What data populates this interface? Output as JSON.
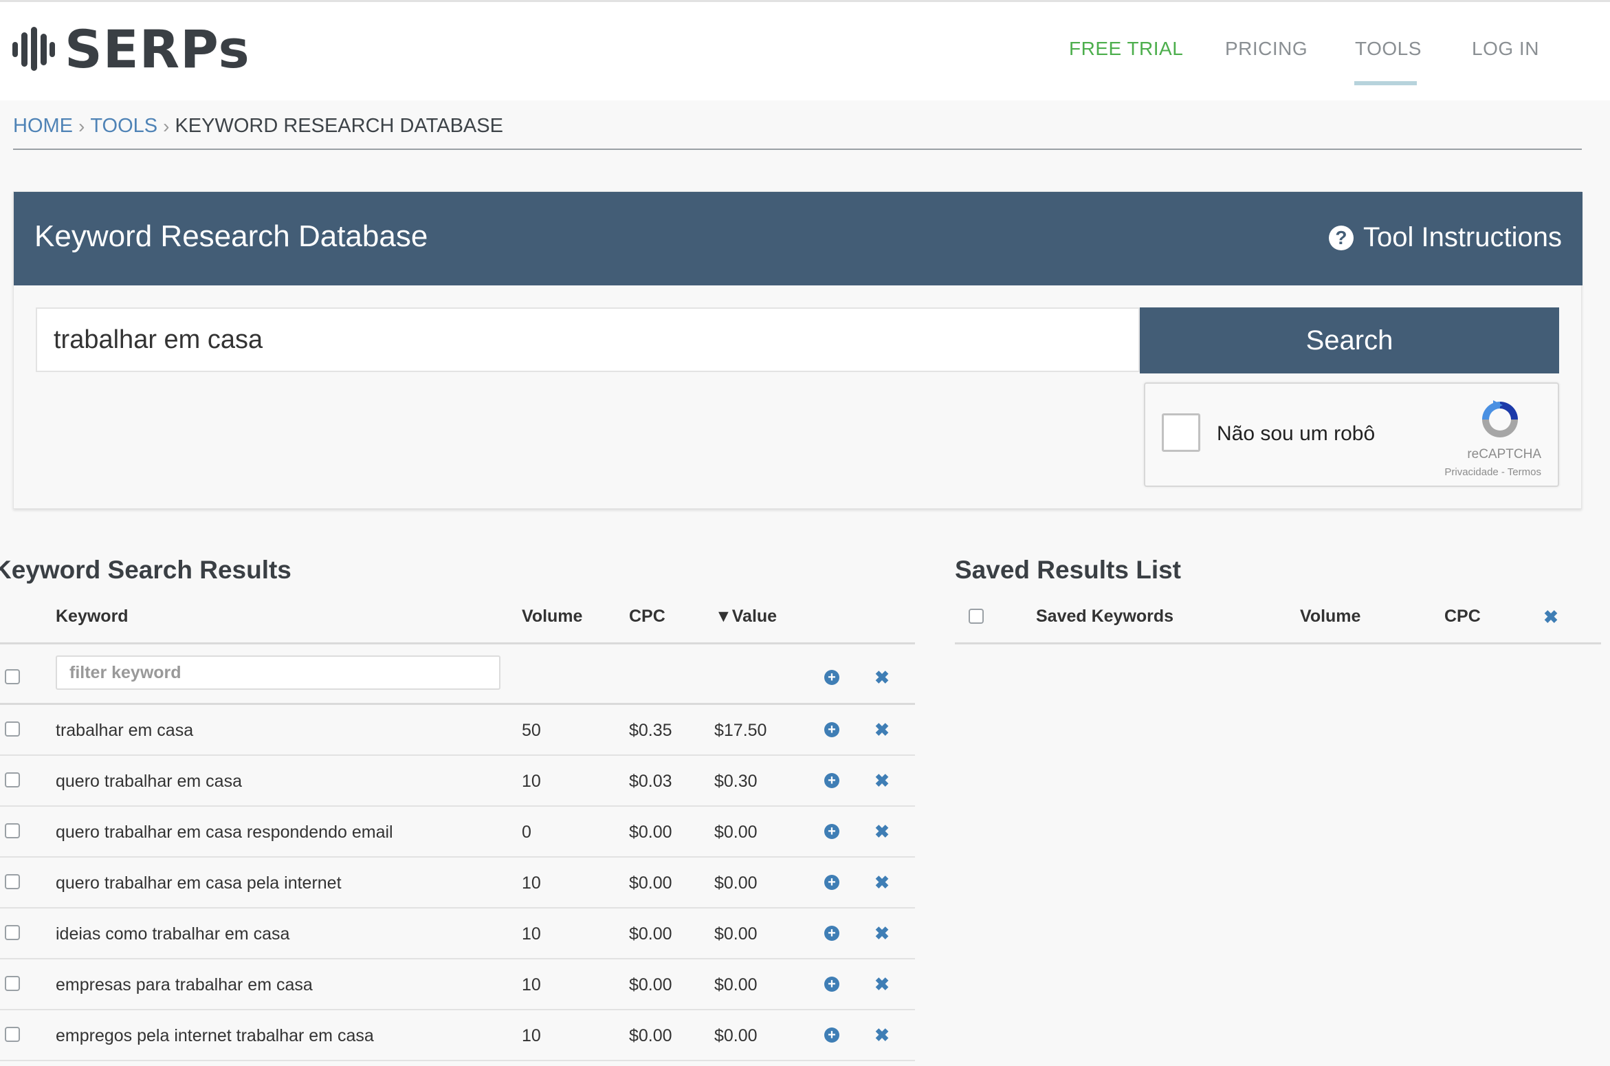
{
  "brand": {
    "name": "SERPs"
  },
  "nav": {
    "free_trial": "FREE TRIAL",
    "pricing": "PRICING",
    "tools": "TOOLS",
    "login": "LOG IN",
    "active": "TOOLS"
  },
  "breadcrumb": {
    "home": "HOME",
    "tools": "TOOLS",
    "current": "KEYWORD RESEARCH DATABASE",
    "separator": "›"
  },
  "panel": {
    "title": "Keyword Research Database",
    "instructions_label": "Tool Instructions",
    "search_value": "trabalhar em casa",
    "search_button": "Search"
  },
  "captcha": {
    "label": "Não sou um robô",
    "brand": "reCAPTCHA",
    "terms": "Privacidade - Termos"
  },
  "results": {
    "title": "Keyword Search Results",
    "columns": {
      "keyword": "Keyword",
      "volume": "Volume",
      "cpc": "CPC",
      "value": "▼Value"
    },
    "filter_placeholder": "filter keyword",
    "rows": [
      {
        "keyword": "trabalhar em casa",
        "volume": "50",
        "cpc": "$0.35",
        "value": "$17.50"
      },
      {
        "keyword": "quero trabalhar em casa",
        "volume": "10",
        "cpc": "$0.03",
        "value": "$0.30"
      },
      {
        "keyword": "quero trabalhar em casa respondendo email",
        "volume": "0",
        "cpc": "$0.00",
        "value": "$0.00"
      },
      {
        "keyword": "quero trabalhar em casa pela internet",
        "volume": "10",
        "cpc": "$0.00",
        "value": "$0.00"
      },
      {
        "keyword": "ideias como trabalhar em casa",
        "volume": "10",
        "cpc": "$0.00",
        "value": "$0.00"
      },
      {
        "keyword": "empresas para trabalhar em casa",
        "volume": "10",
        "cpc": "$0.00",
        "value": "$0.00"
      },
      {
        "keyword": "empregos pela internet trabalhar em casa",
        "volume": "10",
        "cpc": "$0.00",
        "value": "$0.00"
      }
    ]
  },
  "saved": {
    "title": "Saved Results List",
    "columns": {
      "keywords": "Saved Keywords",
      "volume": "Volume",
      "cpc": "CPC"
    }
  },
  "icons": {
    "add": "plus-circle-icon",
    "remove": "x-icon",
    "help": "question-circle-icon",
    "recaptcha": "recaptcha-logo-icon"
  },
  "colors": {
    "header_bar": "#435d76",
    "link_blue": "#4f83b6",
    "free_trial_green": "#4cae4c",
    "icon_blue": "#3f7eb5"
  }
}
